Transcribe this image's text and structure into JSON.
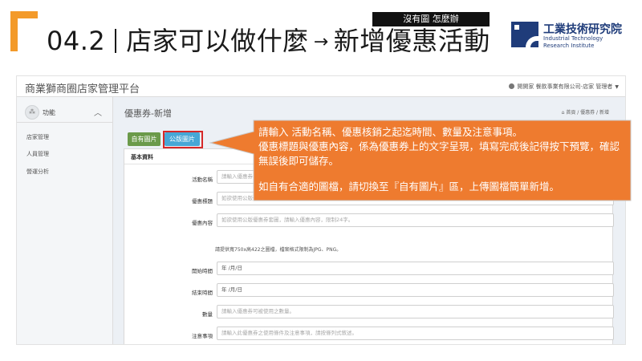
{
  "slide": {
    "title_number": "04.2",
    "title_text": "店家可以做什麼",
    "arrow": "→",
    "subtitle": "新增優惠活動",
    "badge": "沒有圖 怎麼辦",
    "org_name_cn": "工業技術研究院",
    "org_name_en_line1": "Industrial Technology",
    "org_name_en_line2": "Research Institute"
  },
  "app": {
    "title": "商業獅商圈店家管理平台",
    "user": "開開家 餐飲事業有限公司-店家 管理者",
    "sidebar": {
      "section": "功能",
      "items": [
        "店家管理",
        "人員管理",
        "營運分析"
      ]
    },
    "page_heading": "優惠券-新增",
    "breadcrumb": "首頁 / 優惠券 / 新增",
    "tabs": {
      "own": "自有圖片",
      "public": "公版圖片"
    },
    "panel_title": "基本資料",
    "form": {
      "activity_name_label": "活動名稱",
      "activity_name_placeholder": "請輸入優惠券名稱",
      "coupon_title_label": "優惠標題",
      "coupon_title_placeholder": "如欲使用公版優惠券套圖，請輸入優惠標題，限制14字。",
      "coupon_content_label": "優惠內容",
      "coupon_content_placeholder": "如欲使用公版優惠券套圖，請輸入優惠內容，限制24字。",
      "image_note": "請提供寬750x高422之圖檔，檔案格式限制為JPG、PNG。",
      "start_time_label": "開始時間",
      "start_time_value": "年 /月/日",
      "end_time_label": "結束時間",
      "end_time_value": "年 /月/日",
      "quantity_label": "數量",
      "quantity_placeholder": "請輸入優惠券可被使用之數量。",
      "notes_label": "注意事項",
      "notes_placeholder": "請輸入此優惠券之使用條件及注意事項，請按條列式敘述。"
    }
  },
  "callout": {
    "line1": "請輸入 活動名稱、優惠核銷之起迄時間、數量及注意事項。",
    "line2": "優惠標題與優惠內容，係為優惠券上的文字呈現，填寫完成後記得按下預覽，確認無誤後即可儲存。",
    "line3": "如自有合適的圖檔，請切換至『自有圖片』區，上傳圖檔簡單新增。"
  },
  "colors": {
    "accent_orange": "#f39a2a",
    "callout_fill": "#ee7b2f",
    "highlight_red": "#d62828",
    "tab_green": "#6b9a4a",
    "tab_blue": "#47a7d6",
    "logo_blue": "#1f3c7a"
  }
}
